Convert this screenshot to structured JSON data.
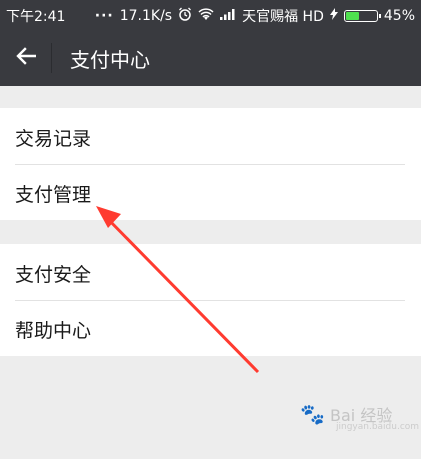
{
  "status_bar": {
    "time": "下午2:41",
    "network_speed": "17.1K/s",
    "carrier": "天官赐福 HD",
    "battery": "45%",
    "battery_level": 0.45
  },
  "app_bar": {
    "title": "支付中心",
    "back_icon": "arrow-left-icon"
  },
  "menu": {
    "group1": [
      {
        "label": "交易记录"
      },
      {
        "label": "支付管理"
      }
    ],
    "group2": [
      {
        "label": "支付安全"
      },
      {
        "label": "帮助中心"
      }
    ]
  },
  "annotation": {
    "arrow_color": "#ff3b30"
  },
  "watermark": {
    "text": "Bai 经验",
    "sub": "jingyan.baidu.com"
  },
  "colors": {
    "toolbar": "#393a3f",
    "background": "#ededed"
  }
}
